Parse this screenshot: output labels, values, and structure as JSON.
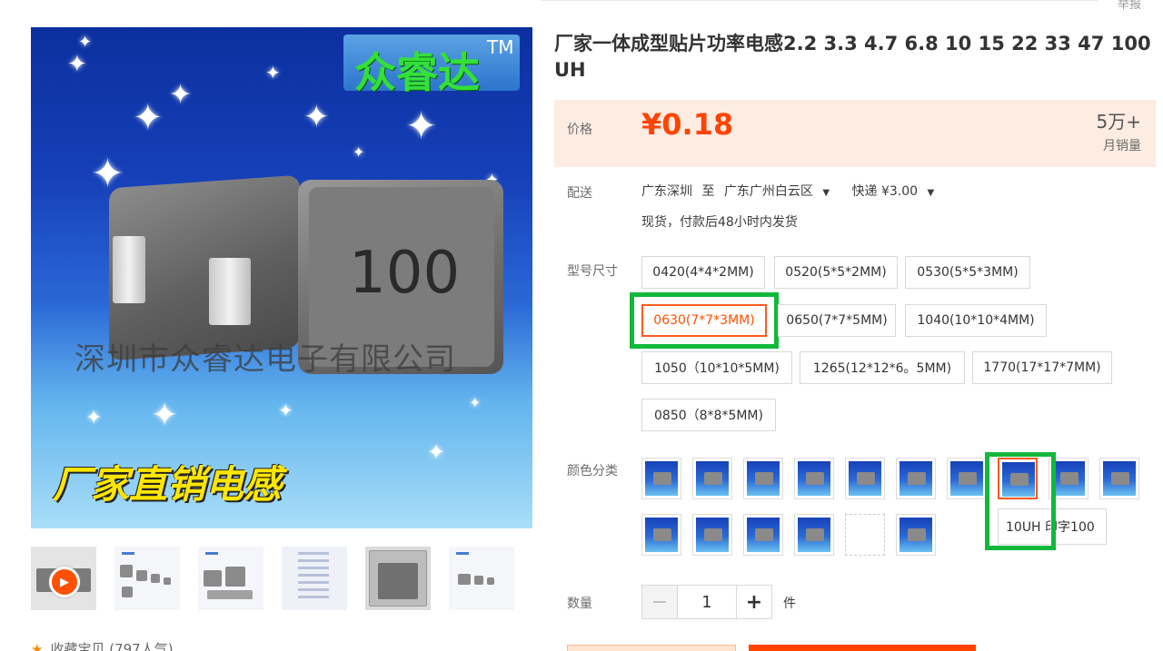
{
  "header": {
    "report_label": "举报"
  },
  "product": {
    "title": "厂家一体成型贴片功率电感2.2 3.3 4.7 6.8 10 15 22 33 47 100 UH",
    "image": {
      "brand": "众睿达",
      "trademark": "TM",
      "inductor_code": "100",
      "company_watermark": "深圳市众睿达电子有限公司",
      "slogan": "厂家直销电感"
    },
    "favorite": "收藏宝贝 (797人气)"
  },
  "price": {
    "label": "价格",
    "value": "¥0.18",
    "monthly_sales": "5万+",
    "monthly_sales_label": "月销量"
  },
  "shipping": {
    "label": "配送",
    "from": "广东深圳",
    "to_word": "至",
    "to": "广东广州白云区",
    "method": "快递 ¥3.00",
    "stock_note": "现货，付款后48小时内发货"
  },
  "size": {
    "label": "型号尺寸",
    "options": [
      "0420(4*4*2MM)",
      "0520(5*5*2MM)",
      "0530(5*5*3MM)",
      "0630(7*7*3MM)",
      "0650(7*7*5MM)",
      "1040(10*10*4MM)",
      "1050（10*10*5MM)",
      "1265(12*12*6。5MM)",
      "1770(17*17*7MM)",
      "0850（8*8*5MM)"
    ],
    "selected": "0630(7*7*3MM)"
  },
  "color": {
    "label": "颜色分类",
    "tooltip": "10UH 印字100"
  },
  "quantity": {
    "label": "数量",
    "minus": "−",
    "value": "1",
    "plus": "+",
    "unit": "件"
  },
  "colors": {
    "accent": "#ff4400",
    "price_bg": "#fdece2",
    "highlight": "#12b83a",
    "selected_border": "#ff5a1f"
  }
}
